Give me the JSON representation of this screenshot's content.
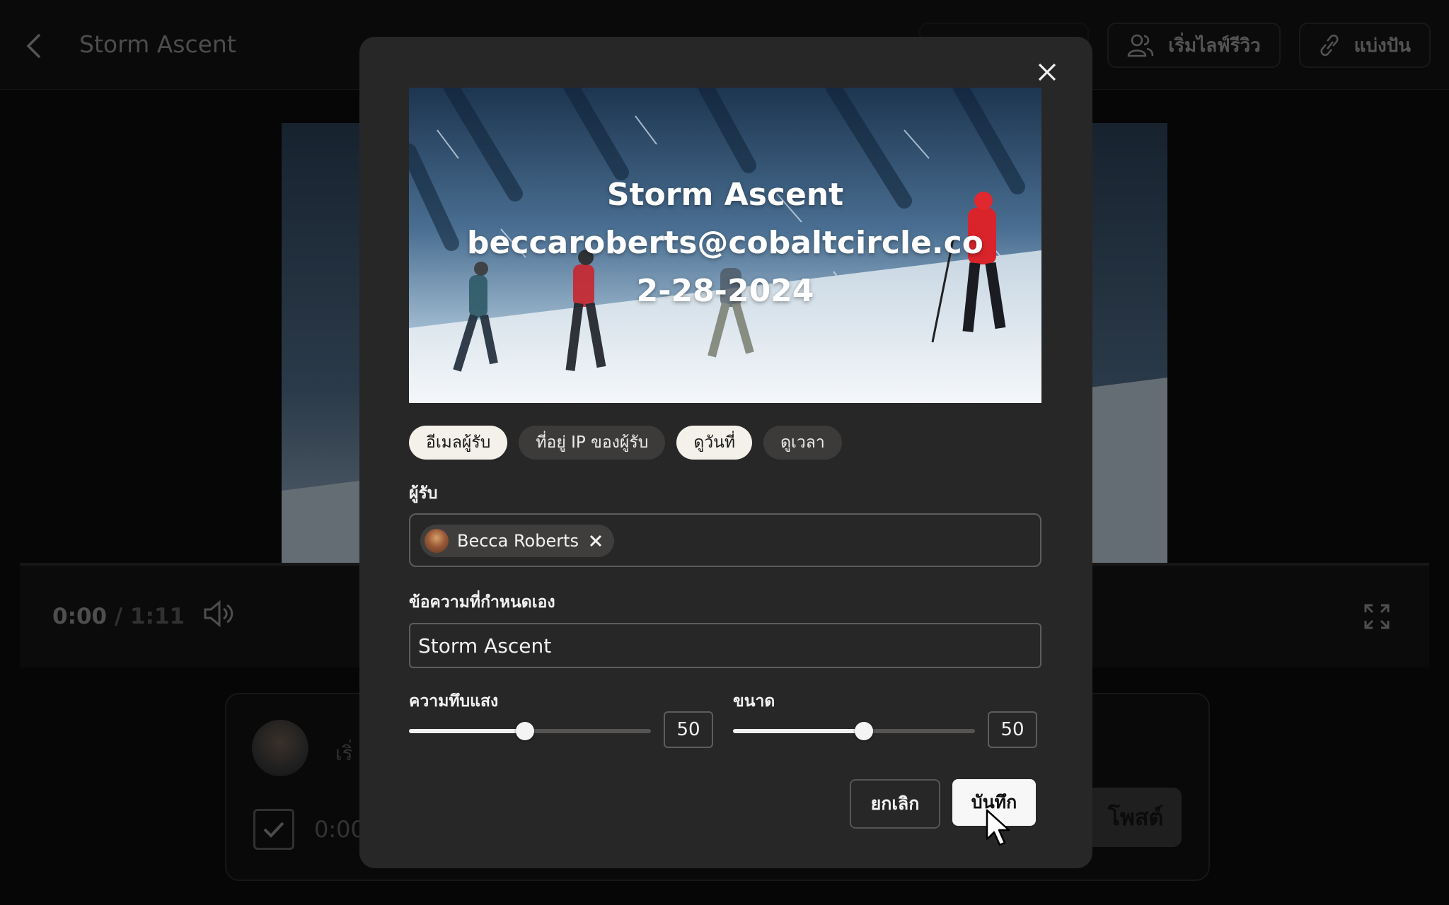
{
  "header": {
    "title": "Storm Ascent",
    "actions": [
      {
        "label": "เริ่มไลฟ์รีวิว",
        "icon": "users-icon"
      },
      {
        "label": "แบ่งปัน",
        "icon": "link-icon"
      }
    ]
  },
  "player": {
    "current_time": "0:00",
    "separator": "/",
    "duration": "1:11"
  },
  "comment": {
    "placeholder": "เริ่",
    "timestamp": "0:00",
    "post_label": "โพสต์"
  },
  "modal": {
    "watermark_lines": [
      "Storm Ascent",
      "beccaroberts@cobaltcircle.co",
      "2-28-2024"
    ],
    "chips": [
      {
        "label": "อีเมลผู้รับ",
        "active": true
      },
      {
        "label": "ที่อยู่ IP ของผู้รับ",
        "active": false
      },
      {
        "label": "ดูวันที่",
        "active": true
      },
      {
        "label": "ดูเวลา",
        "active": false
      }
    ],
    "recipient_label": "ผู้รับ",
    "recipient_name": "Becca Roberts",
    "custom_text_label": "ข้อความที่กำหนดเอง",
    "custom_text_value": "Storm Ascent",
    "opacity_label": "ความทึบแสง",
    "opacity_value": "50",
    "opacity_fraction": 0.48,
    "size_label": "ขนาด",
    "size_value": "50",
    "size_fraction": 0.54,
    "cancel_label": "ยกเลิก",
    "save_label": "บันทึก"
  }
}
